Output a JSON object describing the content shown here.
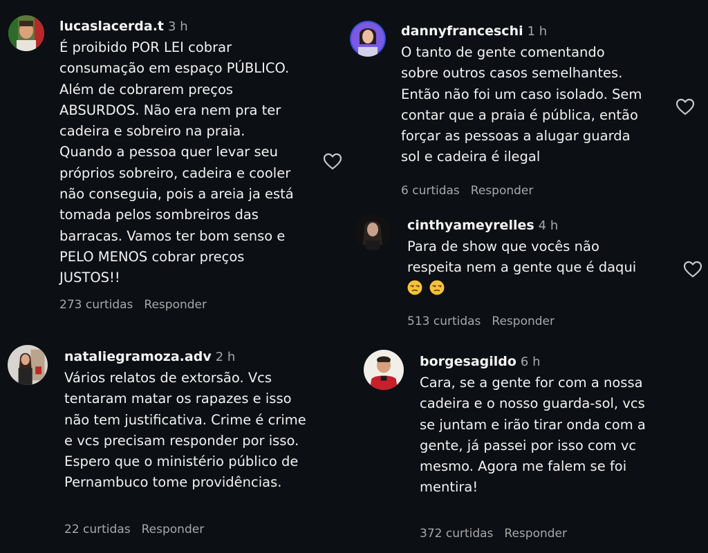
{
  "comments": [
    {
      "username": "lucaslacerda.t",
      "time": "3 h",
      "lines": [
        "É proibido POR LEI cobrar",
        "consumação em espaço PÚBLICO.",
        "Além de cobrarem preços",
        "ABSURDOS. Não era nem pra ter",
        "cadeira e sobreiro na praia.",
        "Quando a pessoa quer levar seu",
        "próprios sobreiro, cadeira e cooler",
        "não conseguia, pois a areia ja está",
        "tomada pelos sombreiros das",
        "barracas. Vamos ter bom senso e",
        "PELO MENOS cobrar preços",
        "JUSTOS!!"
      ],
      "likes": "273 curtidas",
      "reply_label": "Responder",
      "like_icon": "heart-outline-icon"
    },
    {
      "username": "dannyfranceschi",
      "time": "1 h",
      "lines": [
        "O tanto de gente comentando",
        "sobre outros casos semelhantes.",
        "Então não foi um caso isolado. Sem",
        "contar que a praia é pública, então",
        "forçar as pessoas a alugar guarda",
        "sol e cadeira é ilegal"
      ],
      "likes": "6 curtidas",
      "reply_label": "Responder",
      "like_icon": "heart-outline-icon"
    },
    {
      "username": "cinthyameyrelles",
      "time": "4 h",
      "lines": [
        "Para de show que vocês não",
        "respeita nem a gente que é daqui"
      ],
      "emoji_line": [
        "unamused-face-emoji",
        "unamused-face-emoji"
      ],
      "likes": "513 curtidas",
      "reply_label": "Responder",
      "like_icon": "heart-outline-icon"
    },
    {
      "username": "nataliegramoza.adv",
      "time": "2 h",
      "lines": [
        "Vários relatos de extorsão. Vcs",
        "tentaram matar os rapazes e isso",
        "não tem justificativa. Crime é crime",
        "e vcs precisam responder por isso.",
        "Espero que o ministério público de",
        "Pernambuco tome providências."
      ],
      "likes": "22 curtidas",
      "reply_label": "Responder"
    },
    {
      "username": "borgesagildo",
      "time": "6 h",
      "lines": [
        "Cara, se a gente for com a nossa",
        "cadeira e o nosso guarda-sol, vcs",
        "se juntam e irão tirar onda com a",
        "gente, já passei por isso com vc",
        "mesmo. Agora me falem se foi",
        "mentira!"
      ],
      "likes": "372 curtidas",
      "reply_label": "Responder"
    }
  ],
  "colors": {
    "background": "#0c0f14",
    "text": "#f2f2f2",
    "muted": "#a8a8a8"
  }
}
